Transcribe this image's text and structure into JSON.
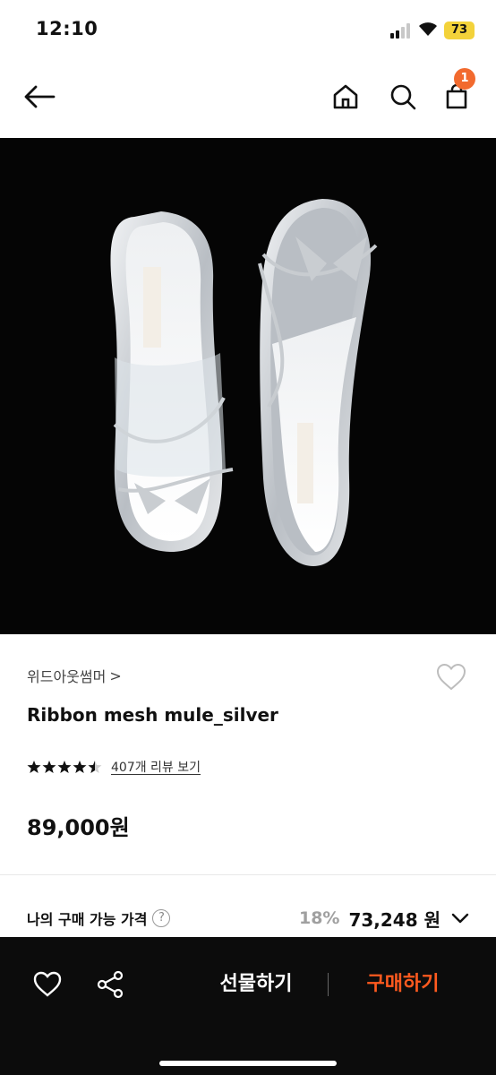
{
  "status": {
    "time": "12:10",
    "battery": "73"
  },
  "nav": {
    "cart_count": "1"
  },
  "product": {
    "brand": "위드아웃썸머",
    "brand_arrow": ">",
    "name": "Ribbon mesh mule_silver",
    "rating": 4.5,
    "review_link": "407개 리뷰 보기",
    "price": "89,000원"
  },
  "my_price": {
    "label": "나의 구매 가능 가격",
    "help": "?",
    "discount": "18%",
    "value": "73,248 원"
  },
  "bottom": {
    "gift_label": "선물하기",
    "buy_label": "구매하기"
  },
  "colors": {
    "accent": "#ff5a1f",
    "badge": "#f26a2e",
    "battery": "#f3d23a",
    "bottom_bar": "#0c0c0c"
  }
}
